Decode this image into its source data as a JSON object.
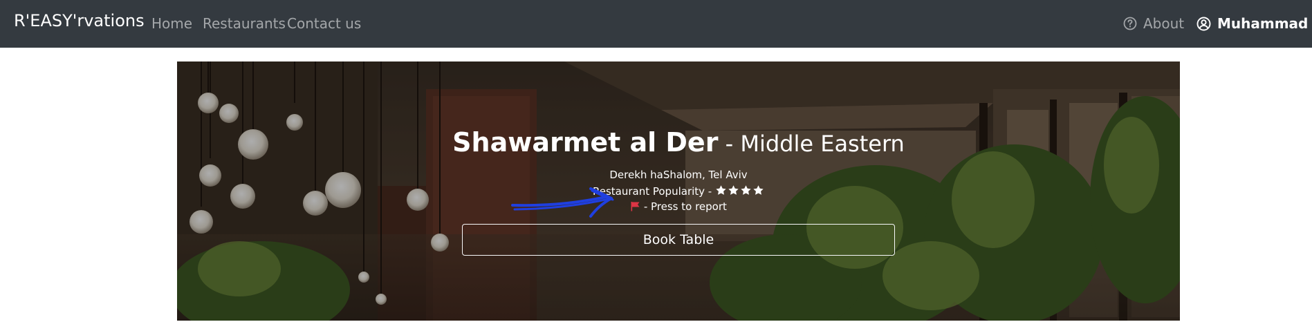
{
  "navbar": {
    "brand": "R'EASY'rvations",
    "links": [
      "Home",
      "Restaurants",
      "Contact us"
    ],
    "about_label": "About",
    "user_name": "Muhammad",
    "bg_color": "#343a40"
  },
  "restaurant": {
    "name": "Shawarmet al Der",
    "separator": " - ",
    "cuisine": "Middle Eastern",
    "address": "Derekh haShalom, Tel Aviv",
    "popularity_label": "Restaurant Popularity -",
    "popularity_stars": 4,
    "report_label": "- Press to report",
    "flag_icon": "red-flag-icon",
    "flag_color": "#dc3545"
  },
  "actions": {
    "book_label": "Book Table"
  }
}
